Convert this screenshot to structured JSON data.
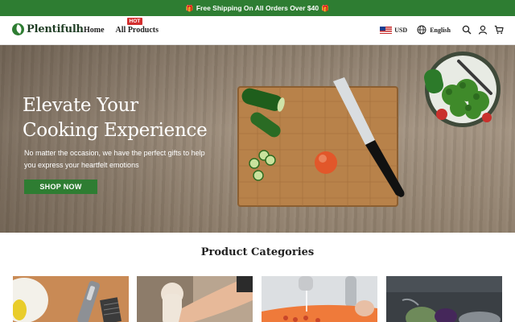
{
  "announcement": {
    "text": "Free Shipping On All Orders Over $40",
    "icon": "gift-icon"
  },
  "header": {
    "logo_text": "Plentifulh",
    "nav": [
      {
        "label": "Home"
      },
      {
        "label": "All Products",
        "badge": "HOT"
      }
    ],
    "currency": "USD",
    "language": "English",
    "icons": [
      "search-icon",
      "account-icon",
      "cart-icon"
    ]
  },
  "hero": {
    "title_line1": "Elevate Your",
    "title_line2": "Cooking Experience",
    "subtitle": "No matter the occasion, we have the perfect gifts to help you express your heartfelt emotions",
    "cta": "SHOP NOW"
  },
  "categories": {
    "title": "Product Categories"
  },
  "colors": {
    "brand": "#2e7d32",
    "badge": "#d32f2f"
  }
}
